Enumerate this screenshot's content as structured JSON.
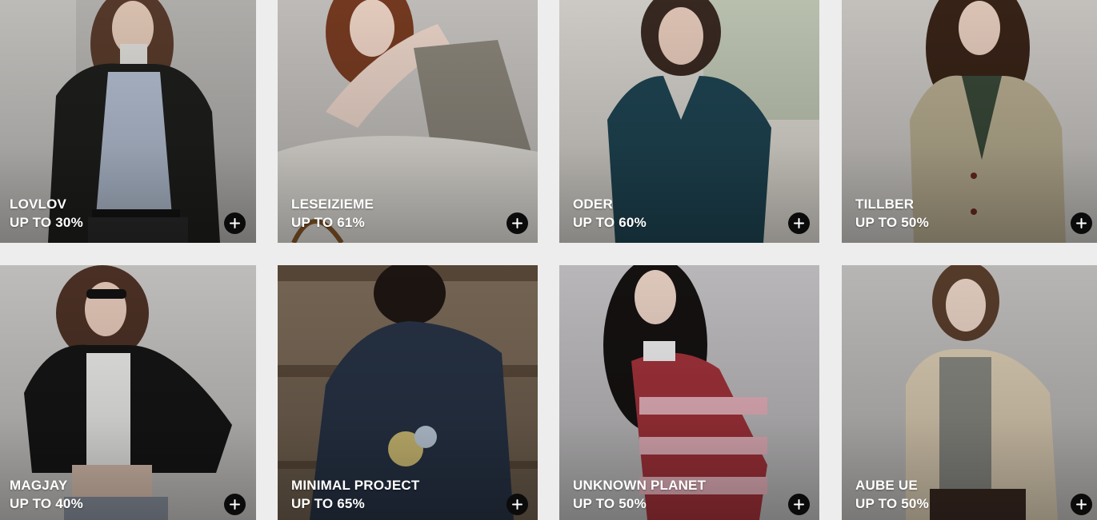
{
  "brands": [
    {
      "name": "LOVLOV",
      "discount": "UP TO 30%",
      "bg": "#b9b7b4",
      "garment": "#1f1f1d",
      "inner": "#b7c3d6",
      "hair": "#5a3c2c"
    },
    {
      "name": "LESEIZIEME",
      "discount": "UP TO 61%",
      "bg": "#c9c6c3",
      "garment": "#e9e6e0",
      "inner": "#8d877c",
      "hair": "#7a3c22"
    },
    {
      "name": "ODER",
      "discount": "UP TO 60%",
      "bg": "#d9d6d0",
      "garment": "#1f4654",
      "inner": "#1f4654",
      "hair": "#3a2a22"
    },
    {
      "name": "TILLBER",
      "discount": "UP TO 50%",
      "bg": "#cfccc8",
      "garment": "#bcb194",
      "inner": "#3a4a3a",
      "hair": "#3a2418"
    },
    {
      "name": "MAGJAY",
      "discount": "UP TO 40%",
      "bg": "#cac8c6",
      "garment": "#161616",
      "inner": "#f3f3f1",
      "hair": "#4e3226"
    },
    {
      "name": "MINIMAL PROJECT",
      "discount": "UP TO 65%",
      "bg": "#5b4a3b",
      "garment": "#283447",
      "inner": "#d9c77a",
      "hair": "#1e1612"
    },
    {
      "name": "UNKNOWN PLANET",
      "discount": "UP TO 50%",
      "bg": "#c4c2c4",
      "garment": "#a8343c",
      "inner": "#efb8c3",
      "hair": "#161212"
    },
    {
      "name": "AUBE UE",
      "discount": "UP TO 50%",
      "bg": "#c3c1bf",
      "garment": "#e2d3b9",
      "inner": "#8c8c86",
      "hair": "#5a3e2c"
    }
  ],
  "icons": {
    "add": "plus-icon"
  }
}
